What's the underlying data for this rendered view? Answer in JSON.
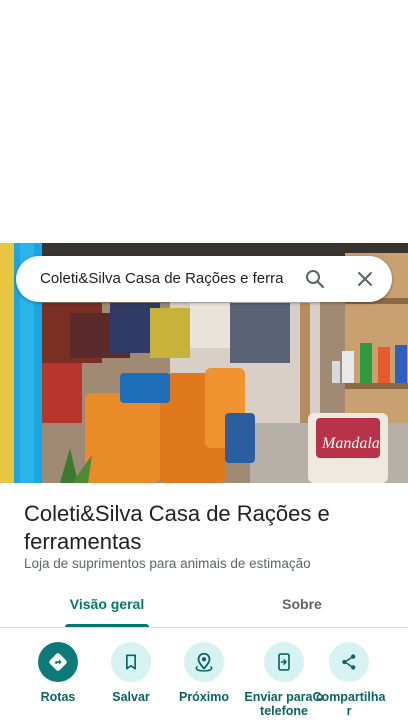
{
  "search": {
    "query": "Coleti&Silva Casa de Rações e ferra"
  },
  "place": {
    "name": "Coleti&Silva Casa de Rações e ferramentas",
    "category": "Loja de suprimentos para animais de estimação"
  },
  "tabs": [
    {
      "label": "Visão geral",
      "active": true
    },
    {
      "label": "Sobre",
      "active": false
    }
  ],
  "actions": [
    {
      "label": "Rotas",
      "icon": "directions-icon"
    },
    {
      "label": "Salvar",
      "icon": "bookmark-icon"
    },
    {
      "label": "Próximo",
      "icon": "nearby-icon"
    },
    {
      "label": "Enviar para o telefone",
      "icon": "send-to-phone-icon"
    },
    {
      "label": "Compartilhar",
      "icon": "share-icon"
    }
  ],
  "colors": {
    "accent": "#00796b",
    "action_primary_bg": "#0b7a79",
    "action_bg": "#d7f2f3",
    "photo_signage": "#1aa6e0"
  },
  "photo": {
    "signage_text": "Mandala"
  }
}
